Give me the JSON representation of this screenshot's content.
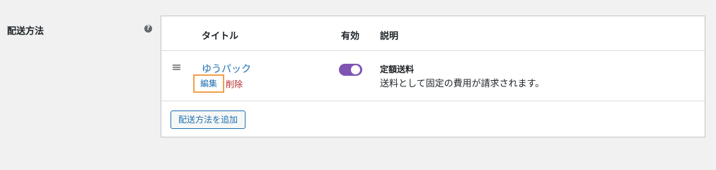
{
  "field": {
    "label": "配送方法",
    "help_icon": "question-circle-icon",
    "help_glyph": "?"
  },
  "table": {
    "headers": {
      "title": "タイトル",
      "enabled": "有効",
      "description": "説明"
    },
    "rows": [
      {
        "title": "ゆうパック",
        "edit_label": "編集",
        "delete_label": "削除",
        "enabled": true,
        "desc_title": "定額送料",
        "desc_text": "送料として固定の費用が請求されます。"
      }
    ],
    "add_button_label": "配送方法を追加"
  },
  "colors": {
    "toggle_on": "#7f54b3",
    "link": "#2271b1",
    "delete": "#b32d2e",
    "highlight": "#f0a04b"
  }
}
